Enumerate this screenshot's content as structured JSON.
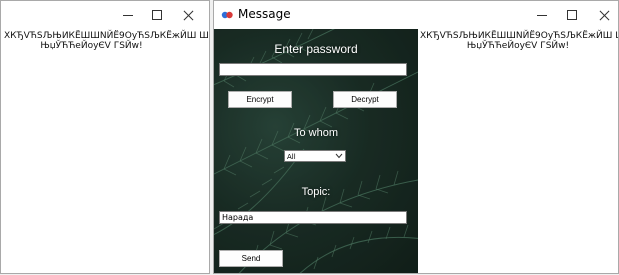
{
  "left_window": {
    "garbled_text": {
      "line1": "ХКЂVЋSЉЊИКЁШШNЙЁ9ОуЋSЉКЁжЙШ Ш",
      "line2": "ЊџЎЋЋеЙоуЄV ГSЙw!"
    }
  },
  "message_window": {
    "title": "Message",
    "form": {
      "password_label": "Enter password",
      "password_value": "",
      "encrypt_label": "Encrypt",
      "decrypt_label": "Decrypt",
      "to_whom_label": "To whom",
      "to_whom_selected": "All",
      "topic_label": "Topic:",
      "topic_value": "Нарада",
      "send_label": "Send"
    },
    "garbled_text": {
      "line1": "ХКЂVЋSЉЊИКЁШШNЙЁ9ОуЋSЉКЁжЙШ Ш",
      "line2": "ЊџЎЋЋеЙоуЄV ГSЙw!"
    }
  },
  "icons": {
    "minimize": "minimize-icon",
    "maximize": "maximize-icon",
    "close": "close-icon",
    "app": "app-icon",
    "dropdown": "chevron-down-icon"
  },
  "colors": {
    "panel_dark": "#1c3028",
    "fern": "#4d7a63",
    "app_icon_blue": "#2e6fd8",
    "app_icon_red": "#d83a3a"
  }
}
